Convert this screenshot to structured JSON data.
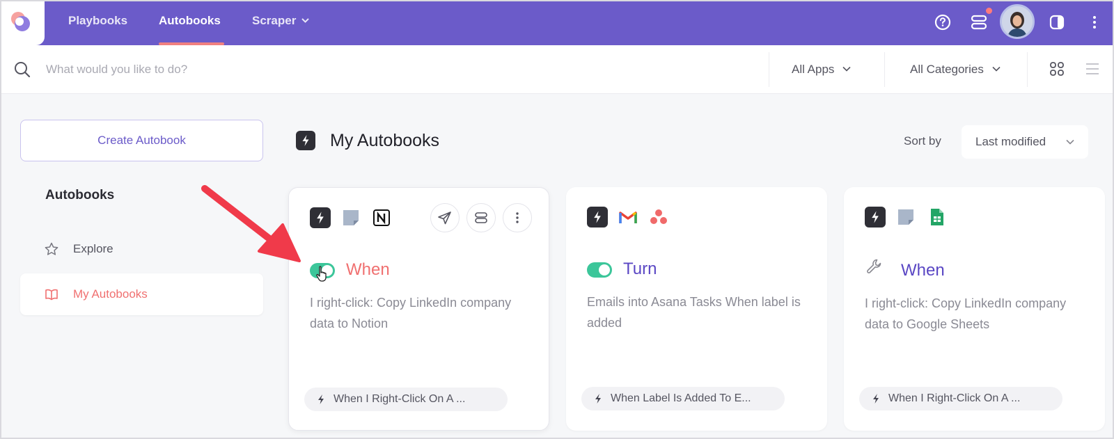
{
  "topbar": {
    "tabs": [
      {
        "label": "Playbooks"
      },
      {
        "label": "Autobooks"
      },
      {
        "label": "Scraper"
      }
    ],
    "active_tab": "Autobooks"
  },
  "search": {
    "placeholder": "What would you like to do?",
    "value": ""
  },
  "filters": {
    "apps": "All Apps",
    "categories": "All Categories"
  },
  "sidebar": {
    "create_button": "Create Autobook",
    "section_title": "Autobooks",
    "items": [
      {
        "label": "Explore",
        "icon": "star-icon"
      },
      {
        "label": "My Autobooks",
        "icon": "book-icon"
      }
    ]
  },
  "main": {
    "title": "My Autobooks",
    "sort_label": "Sort by",
    "sort_value": "Last modified"
  },
  "cards": [
    {
      "apps": [
        "bolt-icon",
        "sticky-note-icon",
        "notion-icon"
      ],
      "status": "toggle-on",
      "title": "When",
      "description": "I right-click: Copy LinkedIn company data to Notion",
      "trigger": "When I Right-Click On A ..."
    },
    {
      "apps": [
        "bolt-icon",
        "gmail-icon",
        "asana-icon"
      ],
      "status": "toggle-on",
      "title": "Turn",
      "description": "Emails into Asana Tasks When label is added",
      "trigger": "When Label Is Added To E..."
    },
    {
      "apps": [
        "bolt-icon",
        "sticky-note-icon",
        "google-sheets-icon"
      ],
      "status": "wrench",
      "title": "When",
      "description": "I right-click: Copy LinkedIn company data to Google Sheets",
      "trigger": "When I Right-Click On A ..."
    }
  ],
  "colors": {
    "brand": "#6b5bc9",
    "accent": "#f07070",
    "toggle": "#3cc69a",
    "annotation_arrow": "#f03a4a"
  }
}
